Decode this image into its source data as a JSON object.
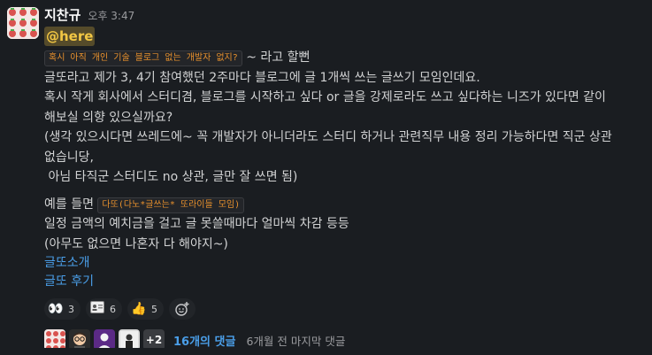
{
  "message": {
    "author": "지찬규",
    "timestamp": "오후 3:47",
    "mention": "@here",
    "intro_code": "혹시 아직 개인 기술 블로그 없는 개발자 없지?",
    "intro_suffix": " ~ 라고 할뻔",
    "lines": [
      "글또라고 제가 3, 4기 참여했던 2주마다 블로그에 글 1개씩 쓰는 글쓰기 모임인데요.",
      "혹시 작게 회사에서 스터디겸, 블로그를 시작하고 싶다 or 글을 강제로라도 쓰고 싶다하는 니즈가 있다면 같이",
      "해보실 의향 있으실까요?",
      "(생각 있으시다면 쓰레드에~ 꼭 개발자가 아니더라도 스터디 하거나 관련직무 내용 정리 가능하다면 직군 상관",
      "없습니당,",
      " 아님 타직군 스터디도 no 상관, 글만 잘 쓰면 됨)"
    ],
    "example_prefix": "예를 들면 ",
    "example_code": "다또(다노*글쓰는* 또라이들 모임)",
    "lines2": [
      "일정 금액의 예치금을 걸고 글 못쓸때마다 얼마씩 차감 등등",
      "(아무도 없으면 나혼자 다 해야지~)"
    ],
    "links": [
      "글또소개",
      "글또 후기"
    ]
  },
  "reactions": [
    {
      "icon": "eyes-icon",
      "glyph": "👀",
      "count": "3"
    },
    {
      "icon": "id-card-icon",
      "glyph": "🪪",
      "count": "6"
    },
    {
      "icon": "thumbs-up-icon",
      "glyph": "👍",
      "count": "5"
    }
  ],
  "thread": {
    "more_participants": "+2",
    "reply_count": "16개의 댓글",
    "last_reply": "6개월 전 마지막 댓글"
  },
  "colors": {
    "background": "#1a1d21",
    "text": "#d1d2d3",
    "link": "#4a9ee8",
    "mention": "#f2c744",
    "code": "#e8912d"
  }
}
